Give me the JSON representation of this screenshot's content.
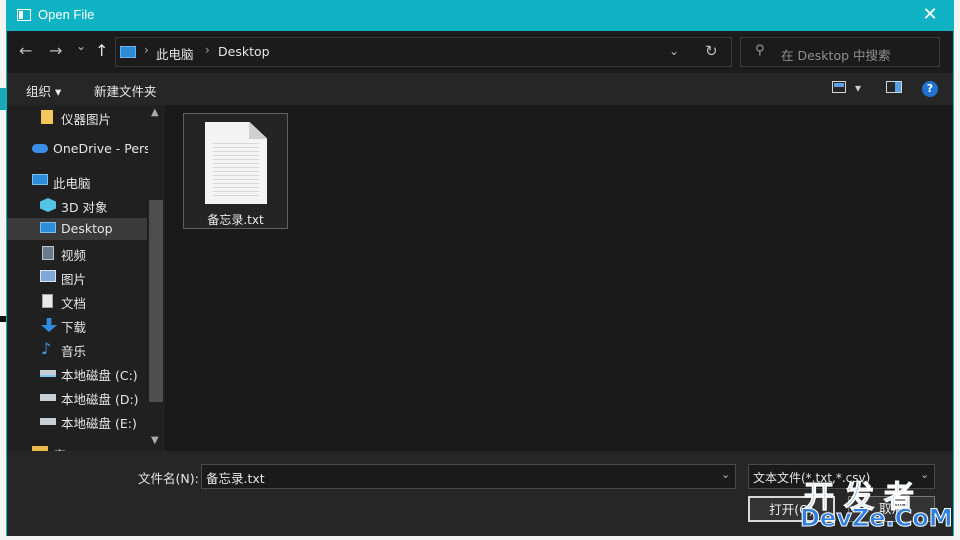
{
  "window": {
    "title": "Open File",
    "close_glyph": "✕"
  },
  "nav": {
    "back": "←",
    "forward": "→",
    "recent": "⌄",
    "up": "↑",
    "breadcrumbs": [
      "此电脑",
      "Desktop"
    ],
    "separator": "›",
    "dropdown": "⌄",
    "refresh": "↻",
    "search_placeholder": "在 Desktop 中搜索",
    "search_icon": "⚲"
  },
  "toolbar": {
    "organize": "组织 ▾",
    "new_folder": "新建文件夹",
    "view_dd": "▾",
    "help": "?"
  },
  "sidebar": {
    "items": [
      {
        "label": "仪器图片",
        "icon": "folder-icon"
      },
      {
        "label": "OneDrive - Perso",
        "icon": "cloud-icon"
      },
      {
        "label": "此电脑",
        "icon": "computer-icon"
      },
      {
        "label": "3D 对象",
        "icon": "cube-icon"
      },
      {
        "label": "Desktop",
        "icon": "desktop-icon",
        "selected": true
      },
      {
        "label": "视频",
        "icon": "video-icon"
      },
      {
        "label": "图片",
        "icon": "picture-icon"
      },
      {
        "label": "文档",
        "icon": "document-icon"
      },
      {
        "label": "下载",
        "icon": "download-icon"
      },
      {
        "label": "音乐",
        "icon": "music-icon"
      },
      {
        "label": "本地磁盘 (C:)",
        "icon": "drive-icon"
      },
      {
        "label": "本地磁盘 (D:)",
        "icon": "drive-icon"
      },
      {
        "label": "本地磁盘 (E:)",
        "icon": "drive-icon"
      },
      {
        "label": "库",
        "icon": "library-icon"
      }
    ],
    "scroll_up": "▲",
    "scroll_down": "▼"
  },
  "files": [
    {
      "name": "备忘录.txt",
      "icon": "text-file-icon"
    }
  ],
  "bottom": {
    "filename_label": "文件名(N):",
    "filename_value": "备忘录.txt",
    "filetype_value": "文本文件(*.txt,*.csv)",
    "dropdown": "⌄",
    "open_label": "打开(O)",
    "cancel_label": "取消"
  },
  "watermark": {
    "top": "开发者",
    "bottom": "DevZe.CoM"
  }
}
